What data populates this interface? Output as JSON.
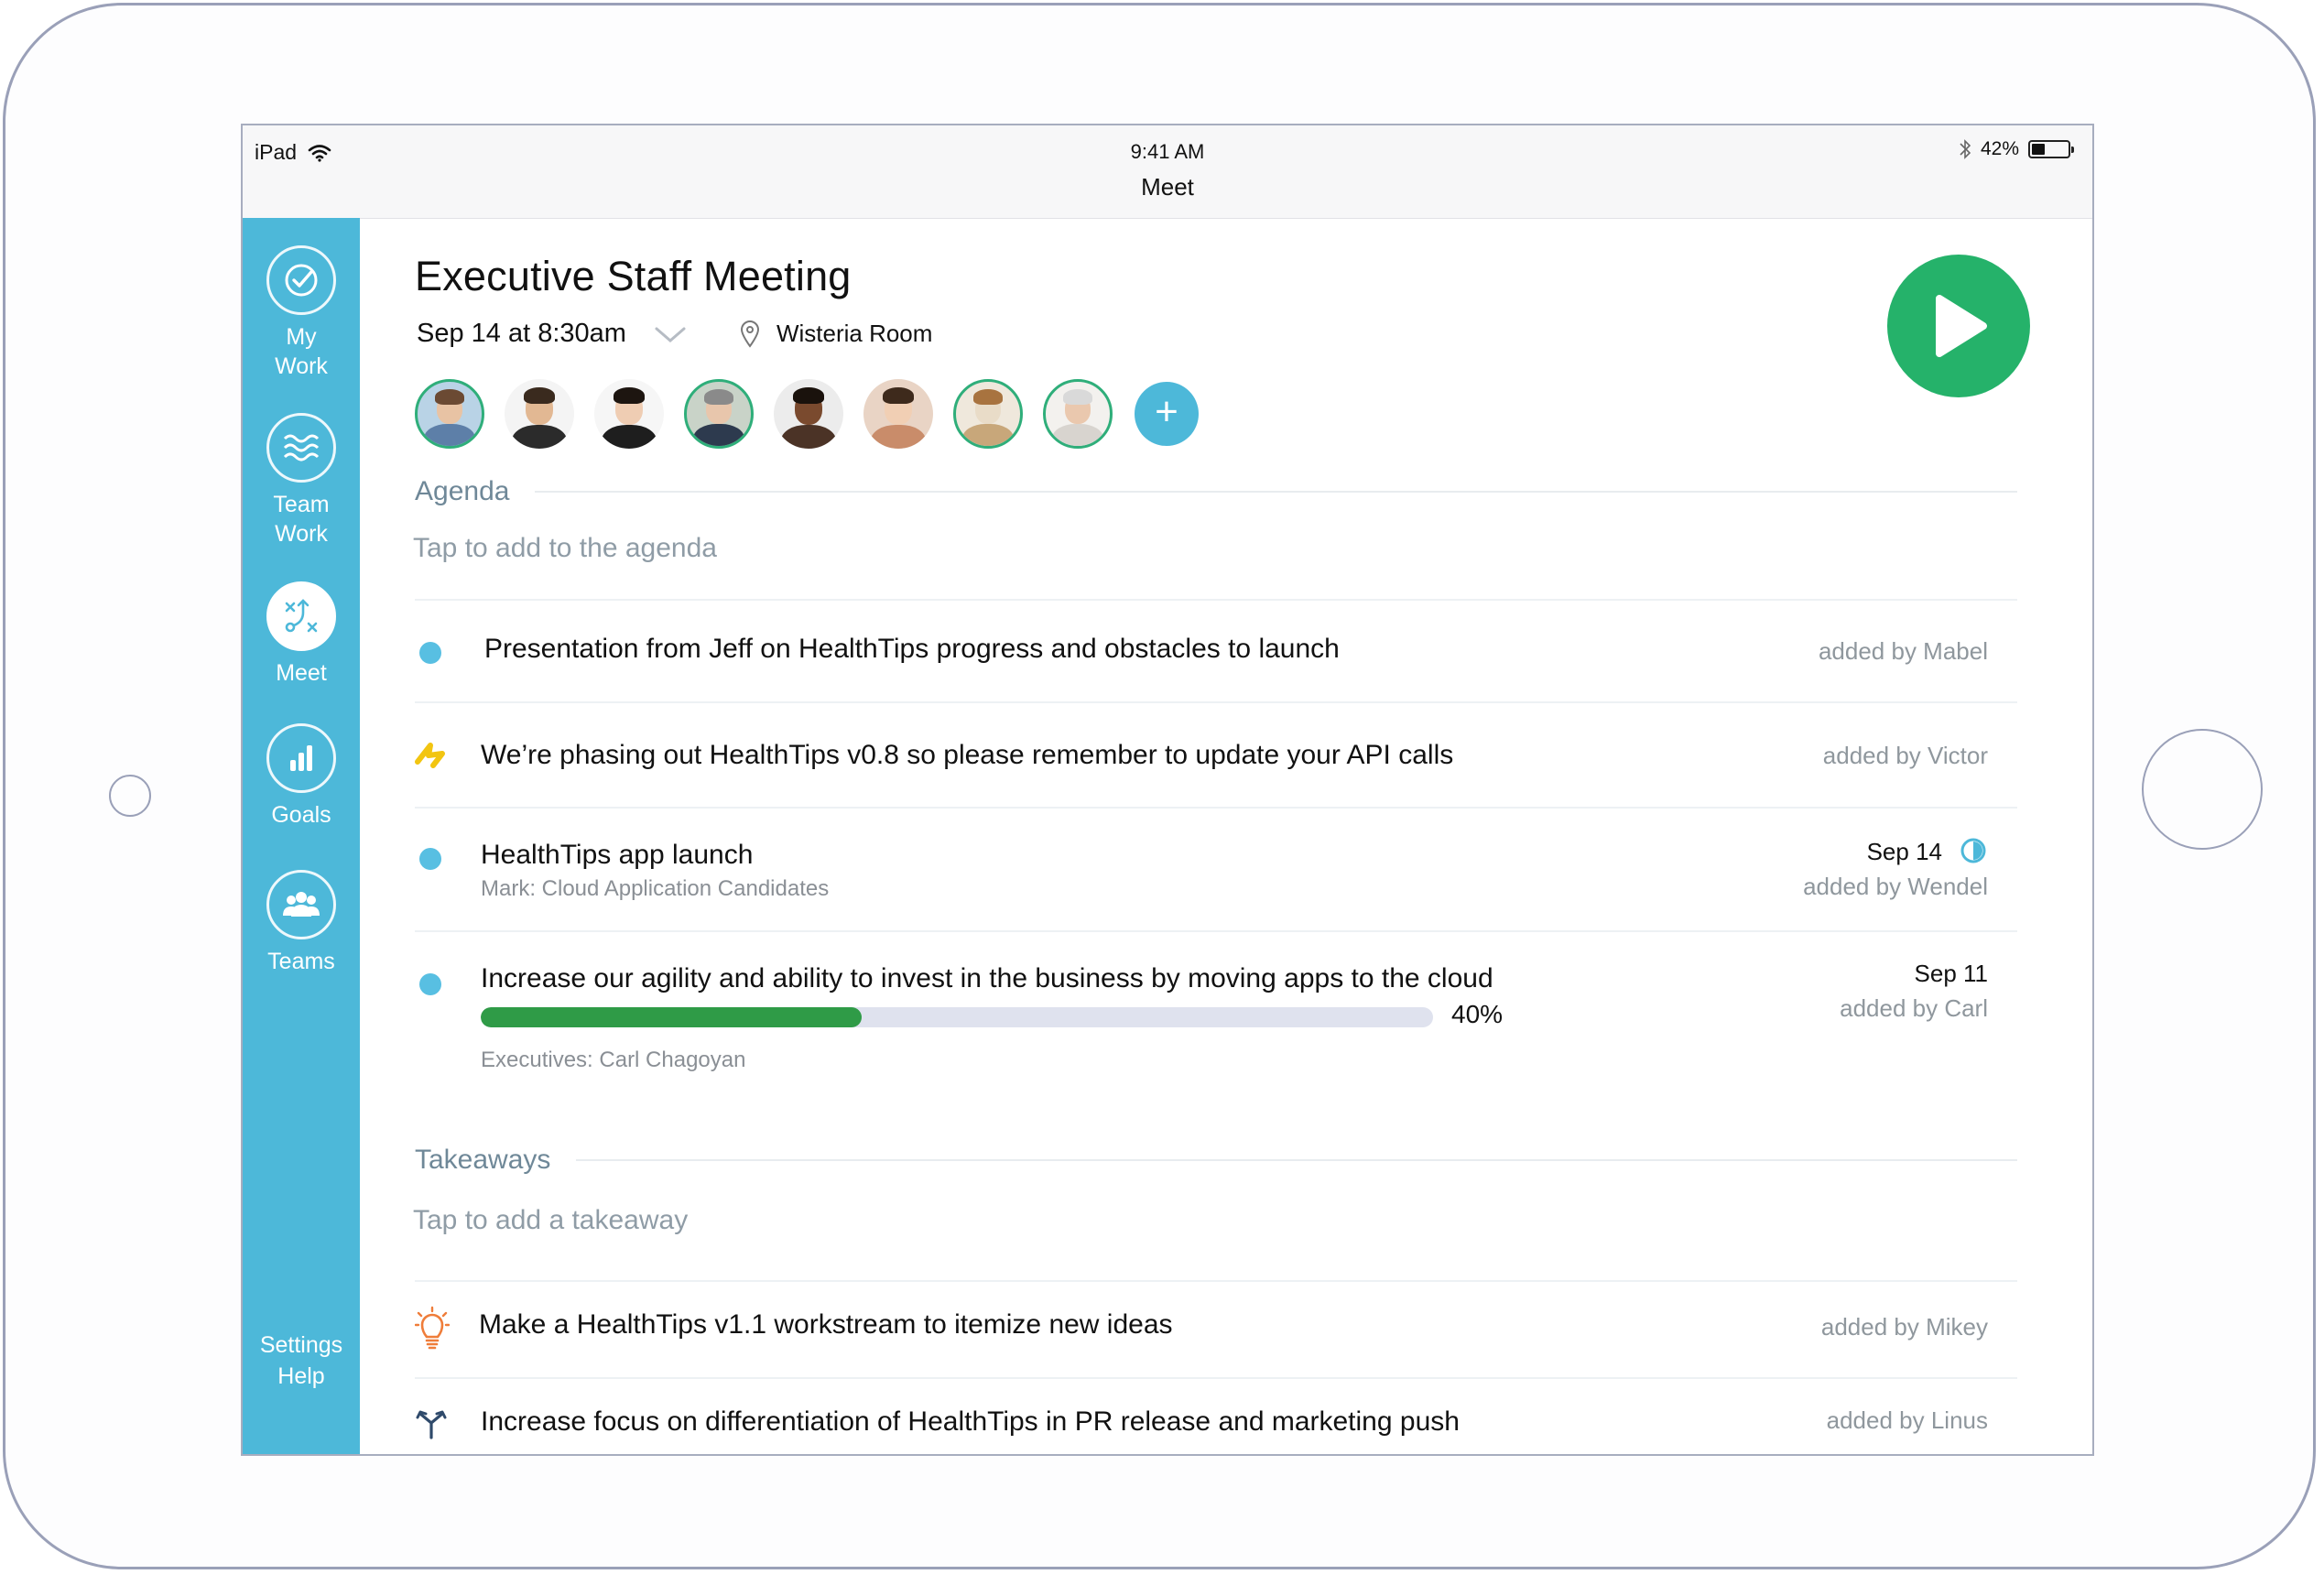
{
  "status_bar": {
    "device": "iPad",
    "time": "9:41 AM",
    "app_title": "Meet",
    "battery_percent": "42%",
    "battery_level": 0.42
  },
  "sidebar": {
    "items": [
      {
        "label": "My\nWork",
        "icon": "check-circle-icon"
      },
      {
        "label": "Team\nWork",
        "icon": "waves-icon"
      },
      {
        "label": "Meet",
        "icon": "playbook-icon",
        "active": true
      },
      {
        "label": "Goals",
        "icon": "bar-chart-icon"
      },
      {
        "label": "Teams",
        "icon": "people-icon"
      }
    ],
    "settings": "Settings",
    "help": "Help"
  },
  "meeting": {
    "title": "Executive Staff Meeting",
    "date": "Sep 14 at 8:30am",
    "location": "Wisteria Room"
  },
  "colors": {
    "sidebar": "#4db8d9",
    "play": "#25b26a",
    "progress": "#2f9b47",
    "bullet": "#58bfe2"
  },
  "agenda": {
    "heading": "Agenda",
    "placeholder": "Tap to add to the agenda",
    "items": [
      {
        "text": "Presentation from Jeff on HealthTips progress and obstacles to launch",
        "added_by": "added by Mabel",
        "icon": "dot-bullet"
      },
      {
        "text": "We’re phasing out HealthTips v0.8 so please remember to update your API calls",
        "added_by": "added by Victor",
        "icon": "lightning-icon"
      },
      {
        "text": "HealthTips app launch",
        "subtitle": "Mark: Cloud Application Candidates",
        "date": "Sep 14",
        "added_by": "added by Wendel",
        "icon": "dot-bullet"
      },
      {
        "text": "Increase our agility and ability to invest in the business by moving apps to the cloud",
        "subtitle": "Executives: Carl Chagoyan",
        "date": "Sep 11",
        "added_by": "added by Carl",
        "progress": 0.4,
        "progress_label": "40%",
        "icon": "dot-bullet"
      }
    ]
  },
  "takeaways": {
    "heading": "Takeaways",
    "placeholder": "Tap to add a takeaway",
    "items": [
      {
        "text": "Make a HealthTips v1.1 workstream to itemize new ideas",
        "added_by": "added by Mikey",
        "icon": "lightbulb-icon"
      },
      {
        "text": "Increase focus on differentiation of HealthTips in PR release and marketing push",
        "added_by": "added by Linus",
        "icon": "fork-icon"
      }
    ]
  }
}
